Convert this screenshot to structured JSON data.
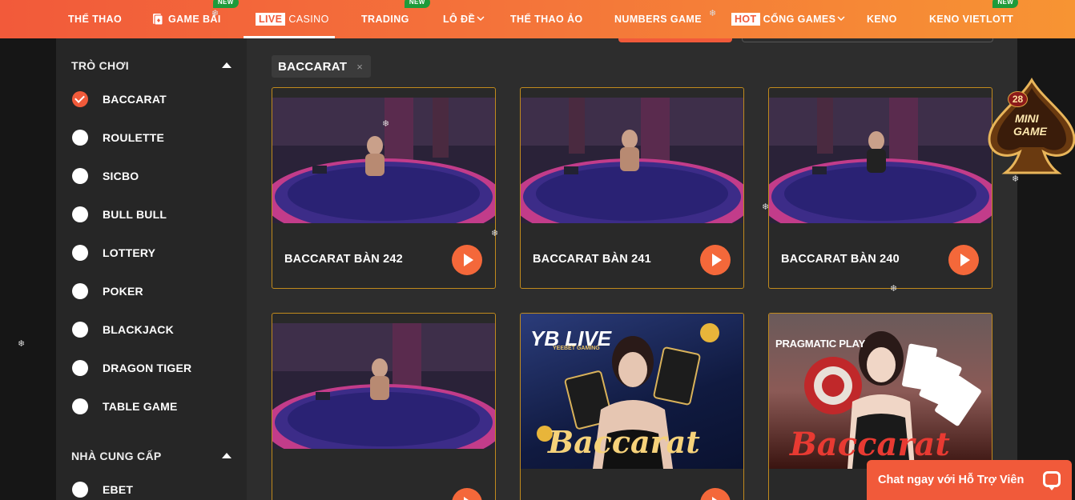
{
  "nav": {
    "items": [
      {
        "label": "THỂ THAO"
      },
      {
        "label": "GAME BÀI",
        "badge": "NEW"
      },
      {
        "label": "CASINO",
        "tag": "LIVE"
      },
      {
        "label": "TRADING",
        "badge": "NEW"
      },
      {
        "label": "LÔ ĐỀ"
      },
      {
        "label": "THỂ THAO ẢO"
      },
      {
        "label": "NUMBERS GAME"
      },
      {
        "label": "CỔNG GAMES",
        "tag": "HOT"
      },
      {
        "label": "KENO"
      },
      {
        "label": "KENO VIETLOTT",
        "badge": "NEW"
      }
    ]
  },
  "sidebar": {
    "games_title": "TRÒ CHƠI",
    "games": [
      {
        "label": "BACCARAT",
        "checked": true
      },
      {
        "label": "ROULETTE"
      },
      {
        "label": "SICBO"
      },
      {
        "label": "BULL BULL"
      },
      {
        "label": "LOTTERY"
      },
      {
        "label": "POKER"
      },
      {
        "label": "BLACKJACK"
      },
      {
        "label": "DRAGON TIGER"
      },
      {
        "label": "TABLE GAME"
      }
    ],
    "providers_title": "NHÀ CUNG CẤP",
    "providers": [
      {
        "label": "EBET"
      }
    ]
  },
  "filter_chip": {
    "label": "BACCARAT",
    "remove": "×"
  },
  "cards": [
    {
      "title": "BACCARAT BÀN 242"
    },
    {
      "title": "BACCARAT BÀN 241"
    },
    {
      "title": "BACCARAT BÀN 240"
    },
    {
      "title": ""
    },
    {
      "title": "",
      "promo_brand": "YB LIVE",
      "promo_sub": "YEEBET GAMING",
      "promo_word": "Baccarat"
    },
    {
      "title": "",
      "promo_brand": "PRAGMATIC PLAY",
      "promo_word": "Baccarat"
    }
  ],
  "minigame": {
    "count": "28",
    "line1": "MINI",
    "line2": "GAME"
  },
  "chat": {
    "label": "Chat ngay với Hỗ Trợ Viên"
  },
  "colors": {
    "accent": "#f15a3a",
    "card_border": "#c08a1d",
    "new_badge": "#1e9b3a"
  }
}
